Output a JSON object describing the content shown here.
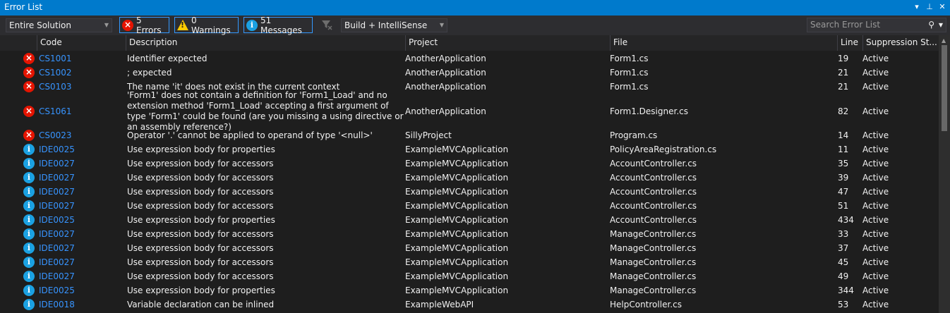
{
  "window": {
    "title": "Error List",
    "buttons": {
      "dropdown": "▾",
      "pin": "⊥",
      "close": "✕"
    }
  },
  "toolbar": {
    "scope": "Entire Solution",
    "errors_label": "5 Errors",
    "warnings_label": "0 Warnings",
    "messages_label": "51 Messages",
    "source": "Build + IntelliSense",
    "search_placeholder": "Search Error List"
  },
  "columns": {
    "code": "Code",
    "description": "Description",
    "project": "Project",
    "file": "File",
    "line": "Line",
    "suppression": "Suppression St..."
  },
  "rows": [
    {
      "type": "error",
      "code": "CS1001",
      "description": "Identifier expected",
      "project": "AnotherApplication",
      "file": "Form1.cs",
      "line": "19",
      "suppression": "Active"
    },
    {
      "type": "error",
      "code": "CS1002",
      "description": "; expected",
      "project": "AnotherApplication",
      "file": "Form1.cs",
      "line": "21",
      "suppression": "Active"
    },
    {
      "type": "error",
      "code": "CS0103",
      "description": "The name 'it' does not exist in the current context",
      "project": "AnotherApplication",
      "file": "Form1.cs",
      "line": "21",
      "suppression": "Active"
    },
    {
      "type": "error",
      "code": "CS1061",
      "description": "'Form1' does not contain a definition for 'Form1_Load' and no extension method 'Form1_Load' accepting a first argument of type 'Form1' could be found (are you missing a using directive or an assembly reference?)",
      "project": "AnotherApplication",
      "file": "Form1.Designer.cs",
      "line": "82",
      "suppression": "Active",
      "tall": true
    },
    {
      "type": "error",
      "code": "CS0023",
      "description": "Operator '.' cannot be applied to operand of type '<null>'",
      "project": "SillyProject",
      "file": "Program.cs",
      "line": "14",
      "suppression": "Active"
    },
    {
      "type": "message",
      "code": "IDE0025",
      "description": "Use expression body for properties",
      "project": "ExampleMVCApplication",
      "file": "PolicyAreaRegistration.cs",
      "line": "11",
      "suppression": "Active"
    },
    {
      "type": "message",
      "code": "IDE0027",
      "description": "Use expression body for accessors",
      "project": "ExampleMVCApplication",
      "file": "AccountController.cs",
      "line": "35",
      "suppression": "Active"
    },
    {
      "type": "message",
      "code": "IDE0027",
      "description": "Use expression body for accessors",
      "project": "ExampleMVCApplication",
      "file": "AccountController.cs",
      "line": "39",
      "suppression": "Active"
    },
    {
      "type": "message",
      "code": "IDE0027",
      "description": "Use expression body for accessors",
      "project": "ExampleMVCApplication",
      "file": "AccountController.cs",
      "line": "47",
      "suppression": "Active"
    },
    {
      "type": "message",
      "code": "IDE0027",
      "description": "Use expression body for accessors",
      "project": "ExampleMVCApplication",
      "file": "AccountController.cs",
      "line": "51",
      "suppression": "Active"
    },
    {
      "type": "message",
      "code": "IDE0025",
      "description": "Use expression body for properties",
      "project": "ExampleMVCApplication",
      "file": "AccountController.cs",
      "line": "434",
      "suppression": "Active"
    },
    {
      "type": "message",
      "code": "IDE0027",
      "description": "Use expression body for accessors",
      "project": "ExampleMVCApplication",
      "file": "ManageController.cs",
      "line": "33",
      "suppression": "Active"
    },
    {
      "type": "message",
      "code": "IDE0027",
      "description": "Use expression body for accessors",
      "project": "ExampleMVCApplication",
      "file": "ManageController.cs",
      "line": "37",
      "suppression": "Active"
    },
    {
      "type": "message",
      "code": "IDE0027",
      "description": "Use expression body for accessors",
      "project": "ExampleMVCApplication",
      "file": "ManageController.cs",
      "line": "45",
      "suppression": "Active"
    },
    {
      "type": "message",
      "code": "IDE0027",
      "description": "Use expression body for accessors",
      "project": "ExampleMVCApplication",
      "file": "ManageController.cs",
      "line": "49",
      "suppression": "Active"
    },
    {
      "type": "message",
      "code": "IDE0025",
      "description": "Use expression body for properties",
      "project": "ExampleMVCApplication",
      "file": "ManageController.cs",
      "line": "344",
      "suppression": "Active"
    },
    {
      "type": "message",
      "code": "IDE0018",
      "description": "Variable declaration can be inlined",
      "project": "ExampleWebAPI",
      "file": "HelpController.cs",
      "line": "53",
      "suppression": "Active"
    }
  ],
  "colors": {
    "accent": "#007acc",
    "error": "#e51400",
    "message": "#1ba1e2",
    "warning": "#ffcc00",
    "link": "#3794ff"
  },
  "icons": {
    "error": "error-icon",
    "warning": "warning-icon",
    "message": "info-icon",
    "filter": "filter-icon",
    "search": "search-icon"
  }
}
